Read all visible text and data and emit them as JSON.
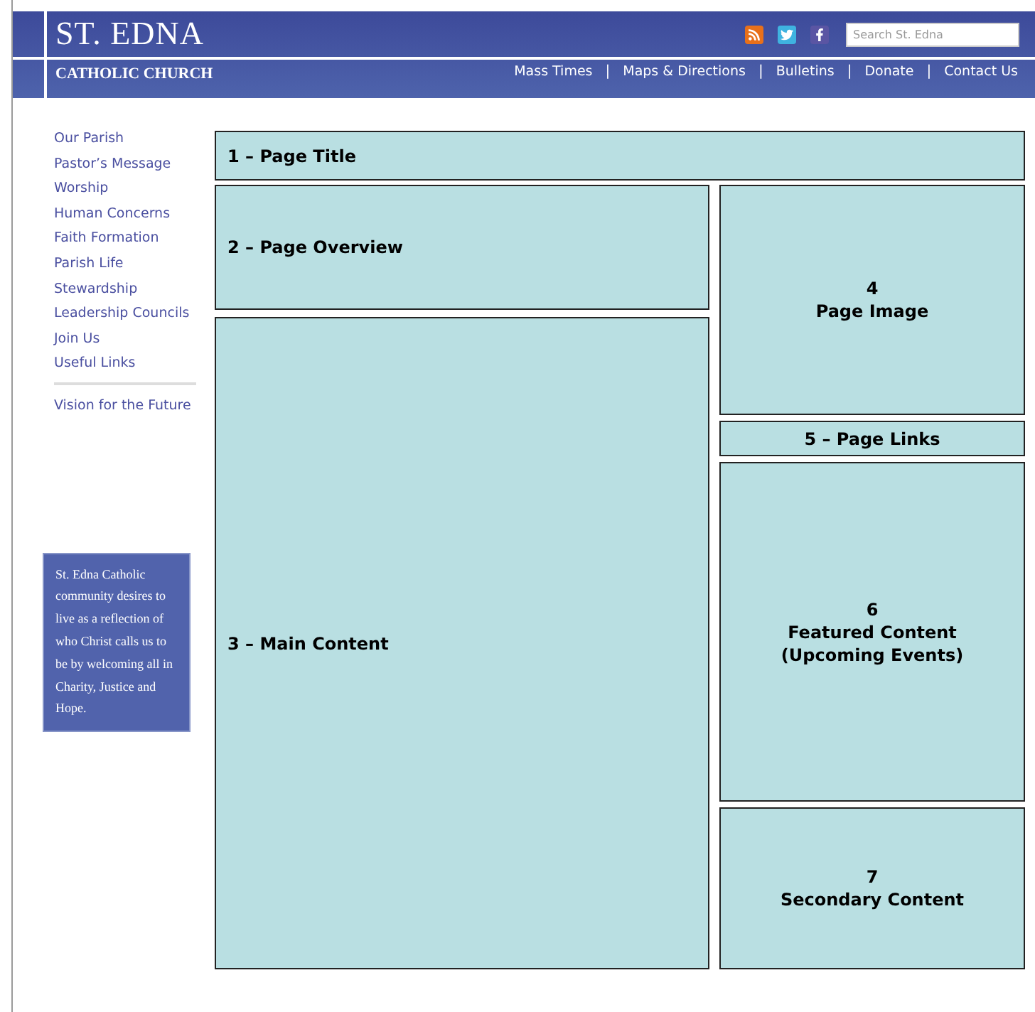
{
  "header": {
    "title": "ST. EDNA",
    "subtitle": "CATHOLIC CHURCH",
    "search": {
      "placeholder": "Search St. Edna"
    },
    "nav": [
      "Mass Times",
      "Maps & Directions",
      "Bulletins",
      "Donate",
      "Contact Us"
    ],
    "separator": "|"
  },
  "sidebar": {
    "items": [
      "Our Parish",
      "Pastor’s Message",
      "Worship",
      "Human Concerns",
      "Faith Formation",
      "Parish Life",
      "Stewardship",
      "Leadership Councils",
      "Join Us",
      "Useful Links"
    ],
    "extra_items": [
      "Vision for the Future"
    ],
    "quote": "St. Edna Catholic community desires to live as a reflection of who Christ calls us to be by welcoming all in Charity, Justice and Hope."
  },
  "title_block": {
    "kind": "left",
    "lines": [
      "1 – Page Title"
    ]
  },
  "left_blocks": [
    {
      "kind": "left",
      "lines": [
        "2 – Page Overview"
      ]
    },
    {
      "kind": "left",
      "lines": [
        "3 – Main Content"
      ]
    }
  ],
  "right_blocks": [
    {
      "kind": "center",
      "lines": [
        "4",
        "Page Image"
      ]
    },
    {
      "kind": "center",
      "lines": [
        "5 – Page Links"
      ]
    },
    {
      "kind": "center",
      "lines": [
        "6",
        "Featured Content",
        "(Upcoming Events)"
      ]
    },
    {
      "kind": "center",
      "lines": [
        "7",
        "Secondary Content"
      ]
    }
  ]
}
